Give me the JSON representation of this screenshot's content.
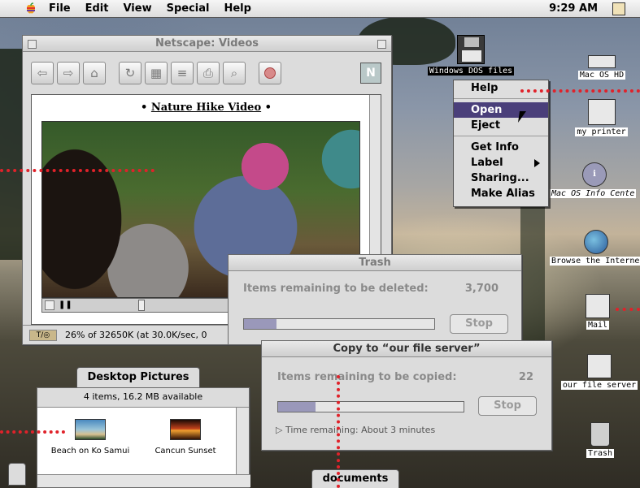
{
  "menubar": {
    "apple_menu": "apple-icon",
    "items": [
      "File",
      "Edit",
      "View",
      "Special",
      "Help"
    ],
    "clock": "9:29 AM",
    "app_icon": "finder-icon"
  },
  "netscape": {
    "title": "Netscape: Videos",
    "toolbar_icons": [
      "back-icon",
      "forward-icon",
      "home-icon",
      "reload-icon",
      "images-icon",
      "open-icon",
      "print-icon",
      "find-icon",
      "stop-icon"
    ],
    "heading_prefix": "•",
    "heading": "Nature Hike Video",
    "heading_suffix": "•",
    "status": "26% of 32650K (at 30.0K/sec, 0"
  },
  "context_menu": {
    "items": [
      "Help",
      "Open",
      "Eject",
      "Get Info",
      "Label",
      "Sharing...",
      "Make Alias"
    ],
    "selected": "Open"
  },
  "desktop_icons": {
    "floppy": "Windows DOS files",
    "hd": "Mac OS HD",
    "printer": "my printer",
    "info": "Mac OS Info Cente",
    "browse": "Browse the Interne",
    "mail": "Mail",
    "server": "our file server",
    "trash": "Trash"
  },
  "trash_window": {
    "title": "Trash",
    "label": "Items remaining to be deleted:",
    "count": "3,700",
    "progress": 0.17,
    "stop": "Stop"
  },
  "copy_window": {
    "title": "Copy to “our file server”",
    "label": "Items remaining to be copied:",
    "count": "22",
    "progress": 0.2,
    "stop": "Stop",
    "time_remaining": "Time remaining: About 3 minutes"
  },
  "desktop_pictures": {
    "tab_label": "Desktop Pictures",
    "info": "4 items, 16.2 MB available",
    "items": [
      "Beach on Ko Samui",
      "Cancun Sunset"
    ]
  },
  "documents_tab": "documents",
  "colors": {
    "callout": "#e0222a",
    "menu_highlight": "#4a3f7a",
    "progress_fill": "#9a98ba"
  }
}
